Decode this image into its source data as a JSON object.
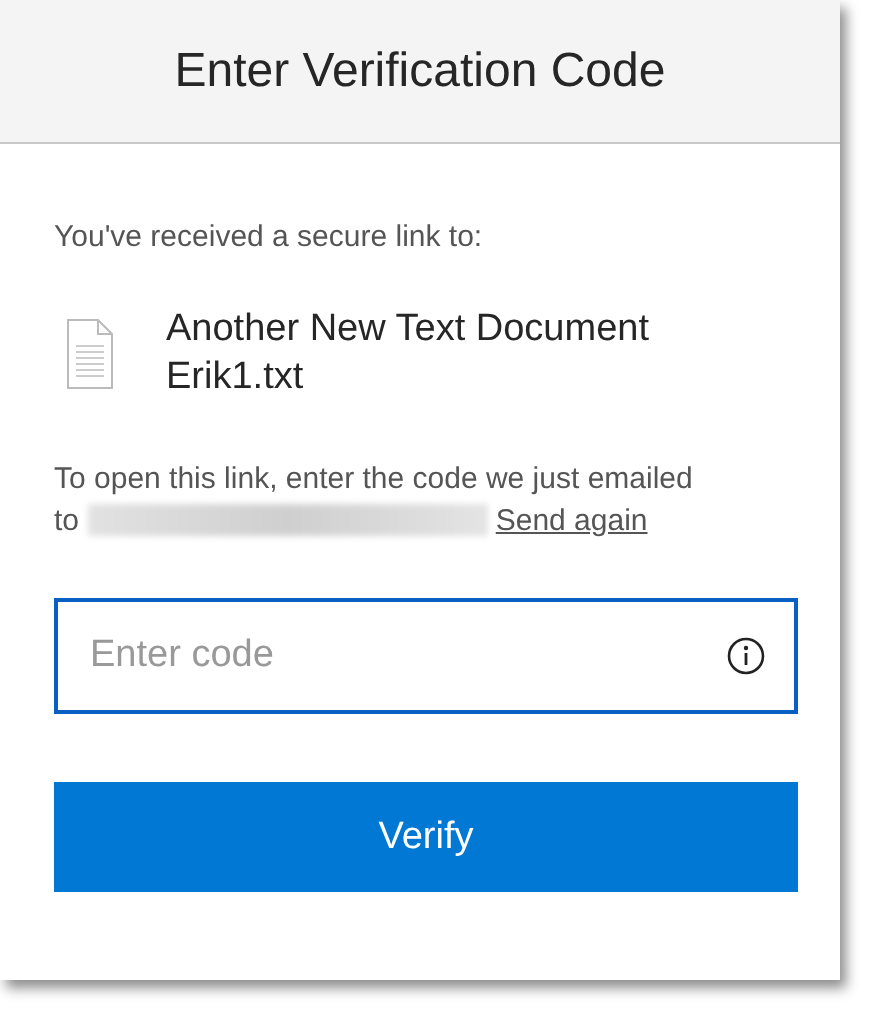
{
  "dialog": {
    "title": "Enter Verification Code"
  },
  "intro": "You've received a secure link to:",
  "file": {
    "name": "Another New Text Document Erik1.txt"
  },
  "instructions": {
    "text": "To open this link, enter the code we just emailed to",
    "redacted": true,
    "link": "Send again"
  },
  "code_field": {
    "placeholder": "Enter code",
    "focused": true
  },
  "verify_button": {
    "label": "Verify"
  }
}
